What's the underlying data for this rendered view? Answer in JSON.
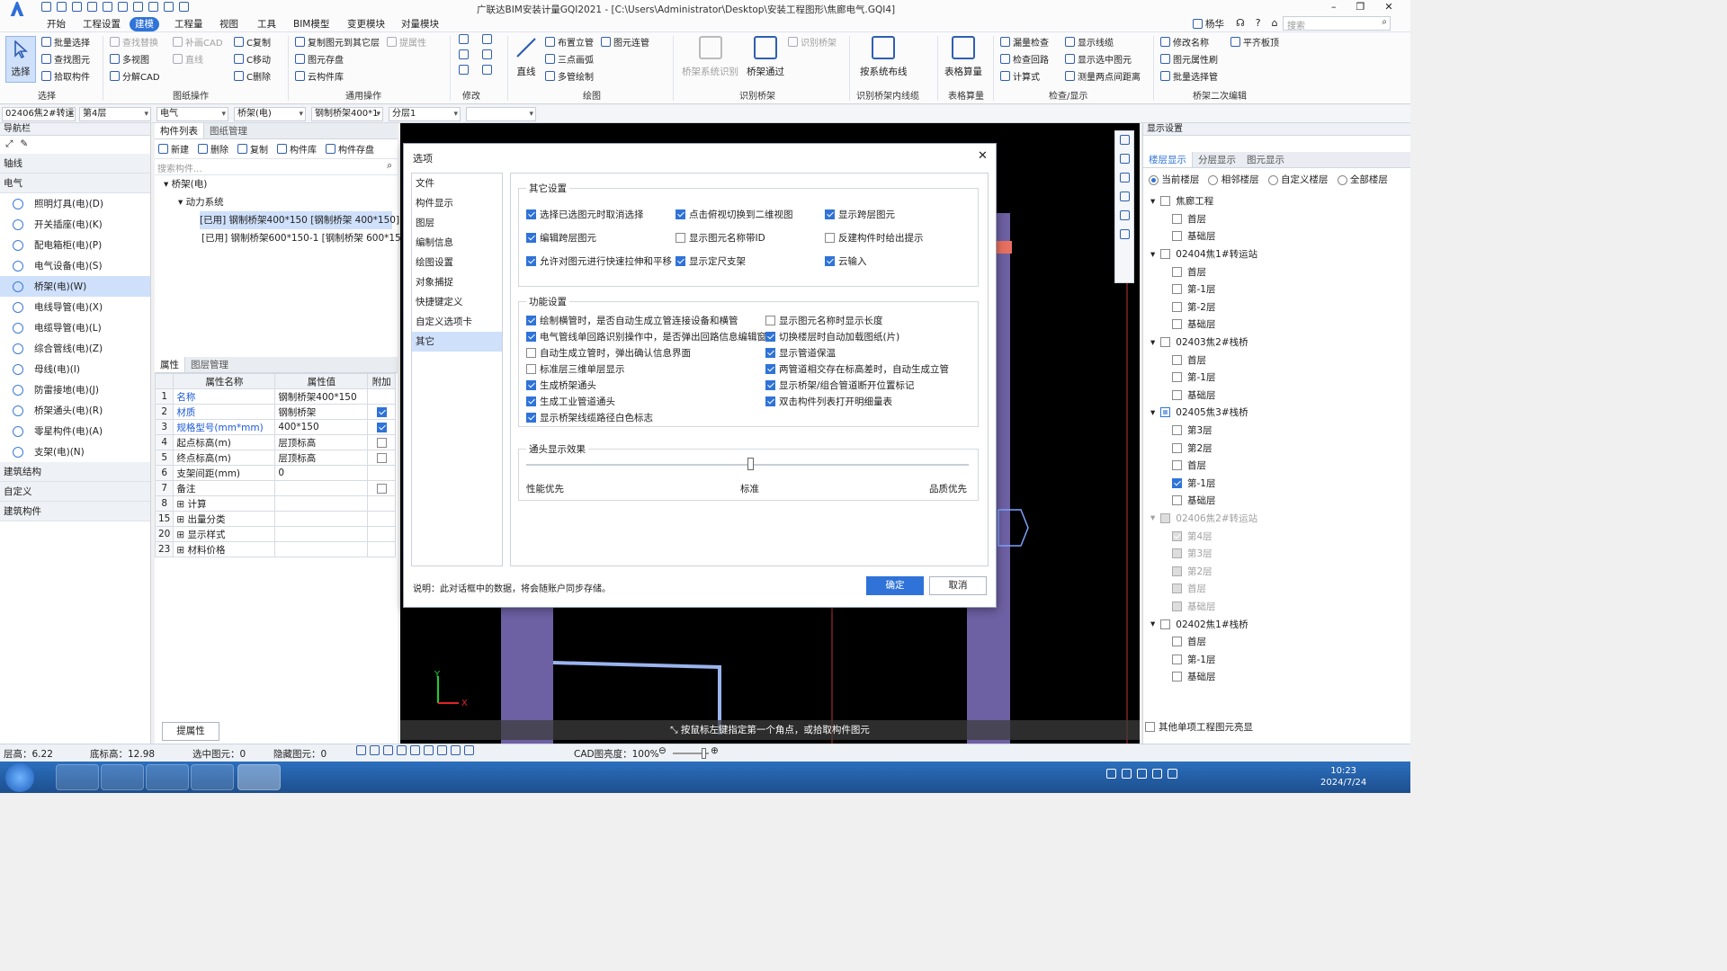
{
  "app": {
    "title": "广联达BIM安装计量GQI2021 - [C:\\Users\\Administrator\\Desktop\\安装工程图形\\焦廊电气.GQI4]",
    "user": "杨华",
    "search_placeholder": "搜索"
  },
  "menu": [
    "开始",
    "工程设置",
    "建模",
    "工程量",
    "视图",
    "工具",
    "BIM模型",
    "变更模块",
    "对量模块"
  ],
  "ribbon": {
    "select": {
      "big": "选择",
      "items": [
        "批量选择",
        "查找图元",
        "拾取构件"
      ],
      "label": "选择"
    },
    "drawing_ops": {
      "items": [
        "查找替换",
        "补画CAD",
        "C复制",
        "多视图",
        "直线",
        "C移动",
        "分解CAD",
        "C删除"
      ],
      "label": "图纸操作"
    },
    "common_ops": {
      "items": [
        "复制图元到其它层",
        "提属性",
        "图元存盘",
        "云构件库"
      ],
      "label": "通用操作"
    },
    "modify": {
      "label": "修改"
    },
    "draw": {
      "big": "直线",
      "items": [
        "布置立管",
        "图元连管",
        "三点画弧",
        "多管绘制"
      ],
      "label": "绘图"
    },
    "identify": {
      "items": [
        "桥架系统识别",
        "桥架通过",
        "识别桥架"
      ],
      "label": "识别桥架"
    },
    "wiring": {
      "big": "按系统布线",
      "label": "识别桥架内线缆"
    },
    "table": {
      "big": "表格算量",
      "label": "表格算量"
    },
    "check": {
      "items": [
        "漏量检查",
        "显示线缆",
        "检查回路",
        "显示选中图元",
        "计算式",
        "测量两点间距离"
      ],
      "label": "检查/显示"
    },
    "bridge_edit": {
      "items": [
        "修改名称",
        "平齐板顶",
        "图元属性刷",
        "批量选择管"
      ],
      "label": "桥架二次编辑"
    }
  },
  "toolbar2": [
    "02406焦2#转运",
    "第4层",
    "电气",
    "桥架(电)",
    "钢制桥架400*1",
    "分层1",
    ""
  ],
  "nav": {
    "title": "导航栏",
    "cats": [
      "轴线",
      "电气",
      "建筑结构",
      "自定义",
      "建筑构件"
    ],
    "items": [
      "照明灯具(电)(D)",
      "开关插座(电)(K)",
      "配电箱柜(电)(P)",
      "电气设备(电)(S)",
      "桥架(电)(W)",
      "电线导管(电)(X)",
      "电缆导管(电)(L)",
      "综合管线(电)(Z)",
      "母线(电)(I)",
      "防雷接地(电)(J)",
      "桥架通头(电)(R)",
      "零星构件(电)(A)",
      "支架(电)(N)"
    ]
  },
  "component": {
    "tabs": [
      "构件列表",
      "图纸管理"
    ],
    "toolbar": [
      "新建",
      "删除",
      "复制",
      "构件库",
      "构件存盘"
    ],
    "search_placeholder": "搜索构件...",
    "tree": [
      "桥架(电)",
      "动力系统",
      "[已用] 钢制桥架400*150 [钢制桥架 400*150]",
      "[已用] 钢制桥架600*150-1 [钢制桥架 600*150]"
    ]
  },
  "props": {
    "tabs": [
      "属性",
      "图层管理"
    ],
    "headers": [
      "属性名称",
      "属性值",
      "附加"
    ],
    "rows": [
      {
        "n": "1",
        "name": "名称",
        "val": "钢制桥架400*150"
      },
      {
        "n": "2",
        "name": "材质",
        "val": "钢制桥架"
      },
      {
        "n": "3",
        "name": "规格型号(mm*mm)",
        "val": "400*150"
      },
      {
        "n": "4",
        "name": "起点标高(m)",
        "val": "层顶标高"
      },
      {
        "n": "5",
        "name": "终点标高(m)",
        "val": "层顶标高"
      },
      {
        "n": "6",
        "name": "支架间距(mm)",
        "val": "0"
      },
      {
        "n": "7",
        "name": "备注",
        "val": ""
      },
      {
        "n": "8",
        "name": "计算",
        "val": ""
      },
      {
        "n": "15",
        "name": "出量分类",
        "val": ""
      },
      {
        "n": "20",
        "name": "显示样式",
        "val": ""
      },
      {
        "n": "23",
        "name": "材料价格",
        "val": ""
      }
    ],
    "button": "提属性"
  },
  "display": {
    "title": "显示设置",
    "tabs": [
      "楼层显示",
      "分层显示",
      "图元显示"
    ],
    "radios": [
      "当前楼层",
      "相邻楼层",
      "自定义楼层",
      "全部楼层"
    ],
    "floors": [
      {
        "t": "焦廊工程",
        "lv": 0,
        "c": 0
      },
      {
        "t": "首层",
        "lv": 1,
        "c": 0
      },
      {
        "t": "基础层",
        "lv": 1,
        "c": 0
      },
      {
        "t": "02404焦1#转运站",
        "lv": 0,
        "c": 0
      },
      {
        "t": "首层",
        "lv": 1,
        "c": 0
      },
      {
        "t": "第-1层",
        "lv": 1,
        "c": 0
      },
      {
        "t": "第-2层",
        "lv": 1,
        "c": 0
      },
      {
        "t": "基础层",
        "lv": 1,
        "c": 0
      },
      {
        "t": "02403焦2#栈桥",
        "lv": 0,
        "c": 0
      },
      {
        "t": "首层",
        "lv": 1,
        "c": 0
      },
      {
        "t": "第-1层",
        "lv": 1,
        "c": 0
      },
      {
        "t": "基础层",
        "lv": 1,
        "c": 0
      },
      {
        "t": "02405焦3#栈桥",
        "lv": 0,
        "c": 2
      },
      {
        "t": "第3层",
        "lv": 1,
        "c": 0
      },
      {
        "t": "第2层",
        "lv": 1,
        "c": 0
      },
      {
        "t": "首层",
        "lv": 1,
        "c": 0
      },
      {
        "t": "第-1层",
        "lv": 1,
        "c": 1
      },
      {
        "t": "基础层",
        "lv": 1,
        "c": 0
      },
      {
        "t": "02406焦2#转运站",
        "lv": 0,
        "c": 3
      },
      {
        "t": "第4层",
        "lv": 1,
        "c": 4
      },
      {
        "t": "第3层",
        "lv": 1,
        "c": 3
      },
      {
        "t": "第2层",
        "lv": 1,
        "c": 3
      },
      {
        "t": "首层",
        "lv": 1,
        "c": 3
      },
      {
        "t": "基础层",
        "lv": 1,
        "c": 3
      },
      {
        "t": "02402焦1#栈桥",
        "lv": 0,
        "c": 0
      },
      {
        "t": "首层",
        "lv": 1,
        "c": 0
      },
      {
        "t": "第-1层",
        "lv": 1,
        "c": 0
      },
      {
        "t": "基础层",
        "lv": 1,
        "c": 0
      }
    ],
    "bottom": "其他单项工程图元亮显"
  },
  "canvas": {
    "hint": "按鼠标左键指定第一个角点，或拾取构件图元",
    "x": "X",
    "y": "Y"
  },
  "status": {
    "floor_h": "层高：6.22",
    "base_h": "底标高：12.98",
    "selected": "选中图元：0",
    "hidden": "隐藏图元：0",
    "cad_brightness": "CAD图亮度：100%"
  },
  "clock": {
    "time": "10:23",
    "date": "2024/7/24"
  },
  "dialog": {
    "title": "选项",
    "nav": [
      "文件",
      "构件显示",
      "图层",
      "编制信息",
      "绘图设置",
      "对象捕捉",
      "快捷键定义",
      "自定义选项卡",
      "其它"
    ],
    "sec1": {
      "title": "其它设置",
      "opts": [
        {
          "l": "选择已选图元时取消选择",
          "c": true
        },
        {
          "l": "点击俯视切换到二维视图",
          "c": true
        },
        {
          "l": "显示跨层图元",
          "c": true
        },
        {
          "l": "编辑跨层图元",
          "c": true
        },
        {
          "l": "显示图元名称带ID",
          "c": false
        },
        {
          "l": "反建构件时给出提示",
          "c": false
        },
        {
          "l": "允许对图元进行快速拉伸和平移",
          "c": true
        },
        {
          "l": "显示定尺支架",
          "c": true
        },
        {
          "l": "云输入",
          "c": true
        }
      ]
    },
    "sec2": {
      "title": "功能设置",
      "left": [
        {
          "l": "绘制横管时，是否自动生成立管连接设备和横管",
          "c": true
        },
        {
          "l": "电气管线单回路识别操作中，是否弹出回路信息编辑窗体",
          "c": true
        },
        {
          "l": "自动生成立管时，弹出确认信息界面",
          "c": false
        },
        {
          "l": "标准层三维单层显示",
          "c": false
        },
        {
          "l": "生成桥架通头",
          "c": true
        },
        {
          "l": "生成工业管道通头",
          "c": true
        },
        {
          "l": "显示桥架线缆路径白色标志",
          "c": true
        }
      ],
      "right": [
        {
          "l": "显示图元名称时显示长度",
          "c": false
        },
        {
          "l": "切换楼层时自动加载图纸(片)",
          "c": true
        },
        {
          "l": "显示管道保温",
          "c": true
        },
        {
          "l": "两管道相交存在标高差时，自动生成立管",
          "c": true
        },
        {
          "l": "显示桥架/组合管道断开位置标记",
          "c": true
        },
        {
          "l": "双击构件列表打开明细量表",
          "c": true
        }
      ]
    },
    "sec3": {
      "title": "通头显示效果",
      "labels": [
        "性能优先",
        "标准",
        "品质优先"
      ],
      "value": 0.5
    },
    "note": "说明：此对话框中的数据，将会随账户同步存储。",
    "ok": "确定",
    "cancel": "取消"
  }
}
